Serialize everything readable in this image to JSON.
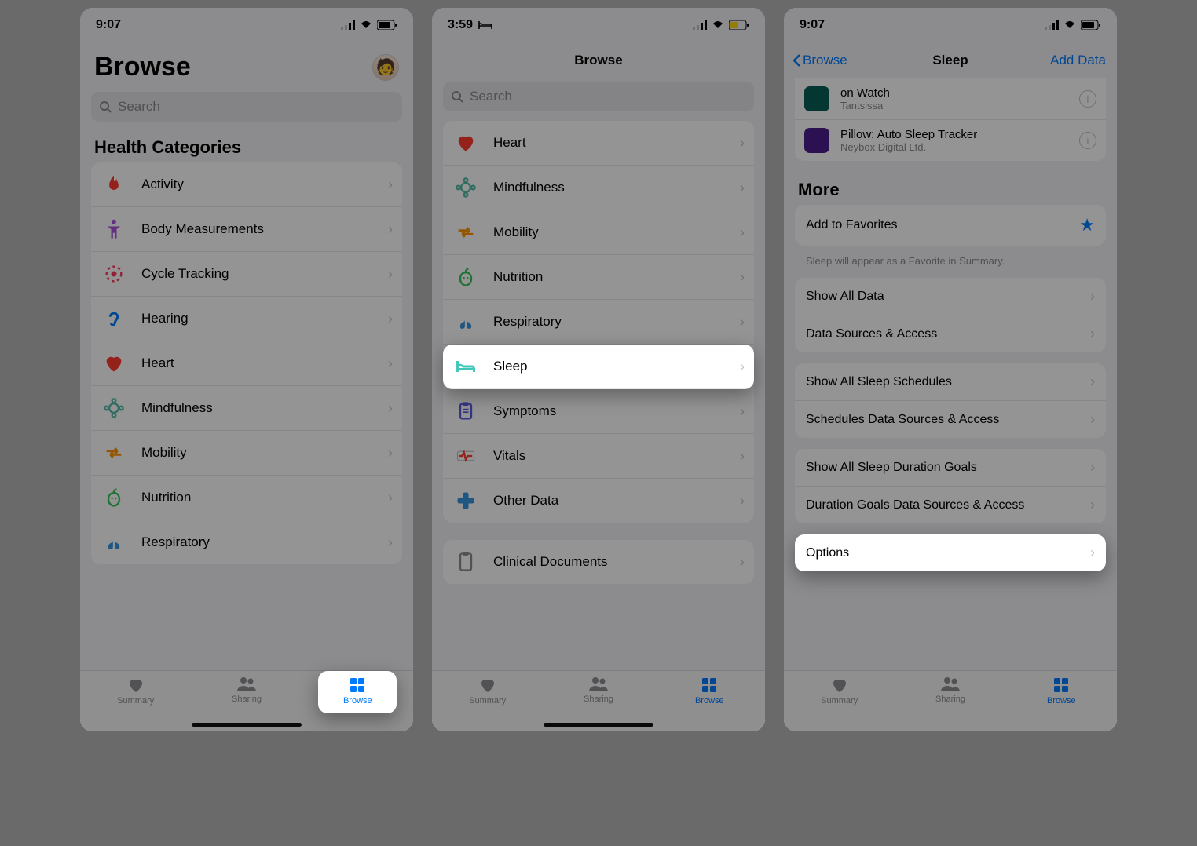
{
  "phone1": {
    "time": "9:07",
    "title": "Browse",
    "search_placeholder": "Search",
    "section": "Health Categories",
    "categories": [
      {
        "label": "Activity",
        "icon": "flame",
        "color": "#ff3b30"
      },
      {
        "label": "Body Measurements",
        "icon": "body",
        "color": "#af52de"
      },
      {
        "label": "Cycle Tracking",
        "icon": "cycle",
        "color": "#ff375f"
      },
      {
        "label": "Hearing",
        "icon": "ear",
        "color": "#007aff"
      },
      {
        "label": "Heart",
        "icon": "heart",
        "color": "#ff3b30"
      },
      {
        "label": "Mindfulness",
        "icon": "mind",
        "color": "#55bea8"
      },
      {
        "label": "Mobility",
        "icon": "mobility",
        "color": "#ff9500"
      },
      {
        "label": "Nutrition",
        "icon": "apple",
        "color": "#34c759"
      },
      {
        "label": "Respiratory",
        "icon": "lungs",
        "color": "#3696e0"
      }
    ],
    "tabs": [
      {
        "label": "Summary",
        "icon": "heart"
      },
      {
        "label": "Sharing",
        "icon": "people"
      },
      {
        "label": "Browse",
        "icon": "grid",
        "active": true
      }
    ]
  },
  "phone2": {
    "time": "3:59",
    "nav_title": "Browse",
    "search_placeholder": "Search",
    "categories": [
      {
        "label": "Heart",
        "icon": "heart",
        "color": "#ff3b30"
      },
      {
        "label": "Mindfulness",
        "icon": "mind",
        "color": "#55bea8"
      },
      {
        "label": "Mobility",
        "icon": "mobility",
        "color": "#ff9500"
      },
      {
        "label": "Nutrition",
        "icon": "apple",
        "color": "#34c759"
      },
      {
        "label": "Respiratory",
        "icon": "lungs",
        "color": "#3696e0"
      },
      {
        "label": "Sleep",
        "icon": "bed",
        "color": "#41c7ba",
        "highlight": true
      },
      {
        "label": "Symptoms",
        "icon": "clipboard",
        "color": "#5e5ce6"
      },
      {
        "label": "Vitals",
        "icon": "vitals",
        "color": "#ff3b30"
      },
      {
        "label": "Other Data",
        "icon": "other",
        "color": "#3696e0"
      }
    ],
    "second_list": [
      {
        "label": "Clinical Documents",
        "icon": "doc",
        "color": "#8e8e93"
      }
    ],
    "tabs": [
      {
        "label": "Summary",
        "icon": "heart"
      },
      {
        "label": "Sharing",
        "icon": "people"
      },
      {
        "label": "Browse",
        "icon": "grid",
        "active": true
      }
    ]
  },
  "phone3": {
    "time": "9:07",
    "back_label": "Browse",
    "nav_title": "Sleep",
    "add_label": "Add Data",
    "apps": [
      {
        "title": "on Watch",
        "sub": "Tantsissa",
        "color": "#0a5f57"
      },
      {
        "title": "Pillow: Auto Sleep Tracker",
        "sub": "Neybox Digital Ltd.",
        "color": "#4b1e8c"
      }
    ],
    "more_title": "More",
    "favorites_label": "Add to Favorites",
    "favorites_note": "Sleep will appear as a Favorite in Summary.",
    "group1": [
      "Show All Data",
      "Data Sources & Access"
    ],
    "group2": [
      "Show All Sleep Schedules",
      "Schedules Data Sources & Access"
    ],
    "group3": [
      "Show All Sleep Duration Goals",
      "Duration Goals Data Sources & Access"
    ],
    "options_label": "Options",
    "tabs": [
      {
        "label": "Summary",
        "icon": "heart"
      },
      {
        "label": "Sharing",
        "icon": "people"
      },
      {
        "label": "Browse",
        "icon": "grid",
        "active": true
      }
    ]
  }
}
